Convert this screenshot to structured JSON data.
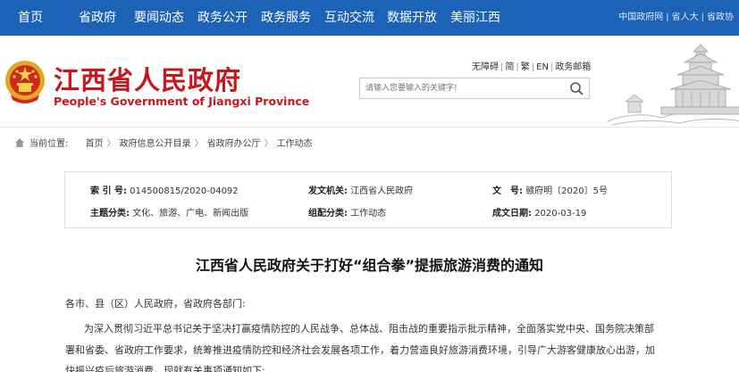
{
  "nav": {
    "items": [
      "首页",
      "省政府",
      "要闻动态",
      "政务公开",
      "政务服务",
      "互动交流",
      "数据开放",
      "美丽江西"
    ],
    "right_links": [
      "中国政府网",
      "省人大",
      "省政协"
    ]
  },
  "header": {
    "title": "江西省人民政府",
    "subtitle": "People's Government of Jiangxi Province",
    "top_links": [
      "无障碍",
      "简",
      "繁",
      "EN",
      "政务邮箱"
    ],
    "search_placeholder": "请输入您要输入的关键字!"
  },
  "breadcrumb": {
    "label": "当前位置:",
    "items": [
      "首页",
      "政府信息公开目录",
      "省政府办公厅",
      "工作动态"
    ]
  },
  "meta": {
    "index_label": "索 引 号:",
    "index_value": "014500815/2020-04092",
    "issuer_label": "发文机关:",
    "issuer_value": "江西省人民政府",
    "docno_label": "文　号:",
    "docno_value": "赣府明〔2020〕5号",
    "topic_label": "主题分类:",
    "topic_value": "文化、旅游、广电、新闻出版",
    "category_label": "组配分类:",
    "category_value": "工作动态",
    "date_label": "成文日期:",
    "date_value": "2020-03-19"
  },
  "article": {
    "title": "江西省人民政府关于打好“组合拳”提振旅游消费的通知",
    "salutation": "各市、县（区）人民政府，省政府各部门:",
    "lines": [
      "为深入贯彻习近平总书记关于坚决打赢疫情防控的人民战争、总体战、阻击战的重要指示批示精神，全面落实党中央、国务院决策部",
      "署和省委、省政府工作要求，统筹推进疫情防控和经济社会发展各项工作，着力营造良好旅游消费环境，引导广大游客健康放心出游，加",
      "快振兴疫后旅游消费，现就有关事项通知如下:"
    ]
  },
  "colors": {
    "nav_bg": "#1c62b6",
    "brand_red": "#c8161d"
  }
}
